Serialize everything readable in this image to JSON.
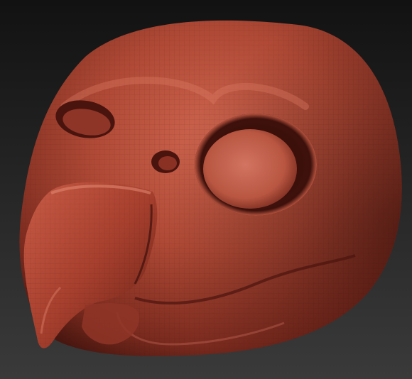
{
  "scene": {
    "background_top": "#121212",
    "background_bottom": "#3a3a3a",
    "clay_highlight": "#d86a52",
    "clay_base": "#a8402e",
    "clay_shadow": "#5a1d14",
    "clay_deep": "#3b100b",
    "subject": "sculpted-bird-head-mask"
  }
}
